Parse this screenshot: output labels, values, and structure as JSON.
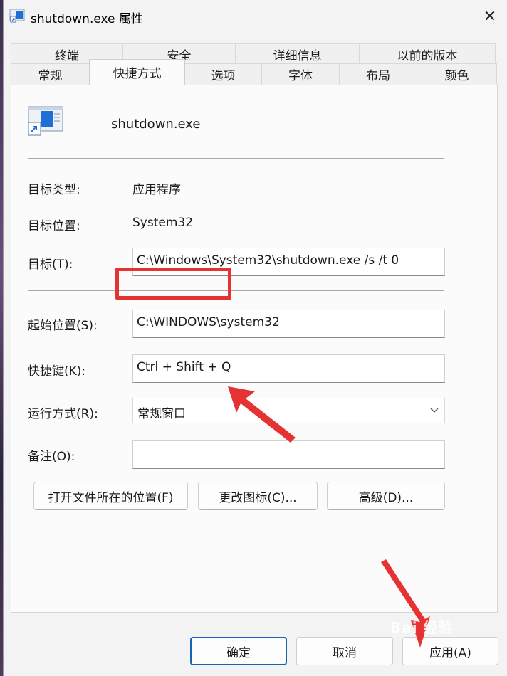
{
  "window": {
    "title": "shutdown.exe 属性",
    "close_label": "✕"
  },
  "tabs": {
    "row1": [
      "终端",
      "安全",
      "详细信息",
      "以前的版本"
    ],
    "row2": [
      "常规",
      "快捷方式",
      "选项",
      "字体",
      "布局",
      "颜色"
    ],
    "active": "快捷方式"
  },
  "shortcut": {
    "name": "shutdown.exe",
    "target_type_label": "目标类型:",
    "target_type_value": "应用程序",
    "target_location_label": "目标位置:",
    "target_location_value": "System32",
    "target_label": "目标(T):",
    "target_value": "C:\\Windows\\System32\\shutdown.exe /s /t 0",
    "start_in_label": "起始位置(S):",
    "start_in_value": "C:\\WINDOWS\\system32",
    "hotkey_label": "快捷键(K):",
    "hotkey_value": "Ctrl + Shift + Q",
    "run_label": "运行方式(R):",
    "run_value": "常规窗口",
    "comment_label": "备注(O):",
    "comment_value": ""
  },
  "actions": {
    "open_location": "打开文件所在的位置(F)",
    "change_icon": "更改图标(C)...",
    "advanced": "高级(D)..."
  },
  "footer": {
    "ok": "确定",
    "cancel": "取消",
    "apply": "应用(A)"
  },
  "watermark": "Bai 经验",
  "colors": {
    "annotation": "#e53232",
    "accent": "#1a62b8"
  },
  "icons": {
    "app_icon": "shortcut-app-icon",
    "close": "close-icon",
    "dropdown": "chevron-down-icon"
  }
}
